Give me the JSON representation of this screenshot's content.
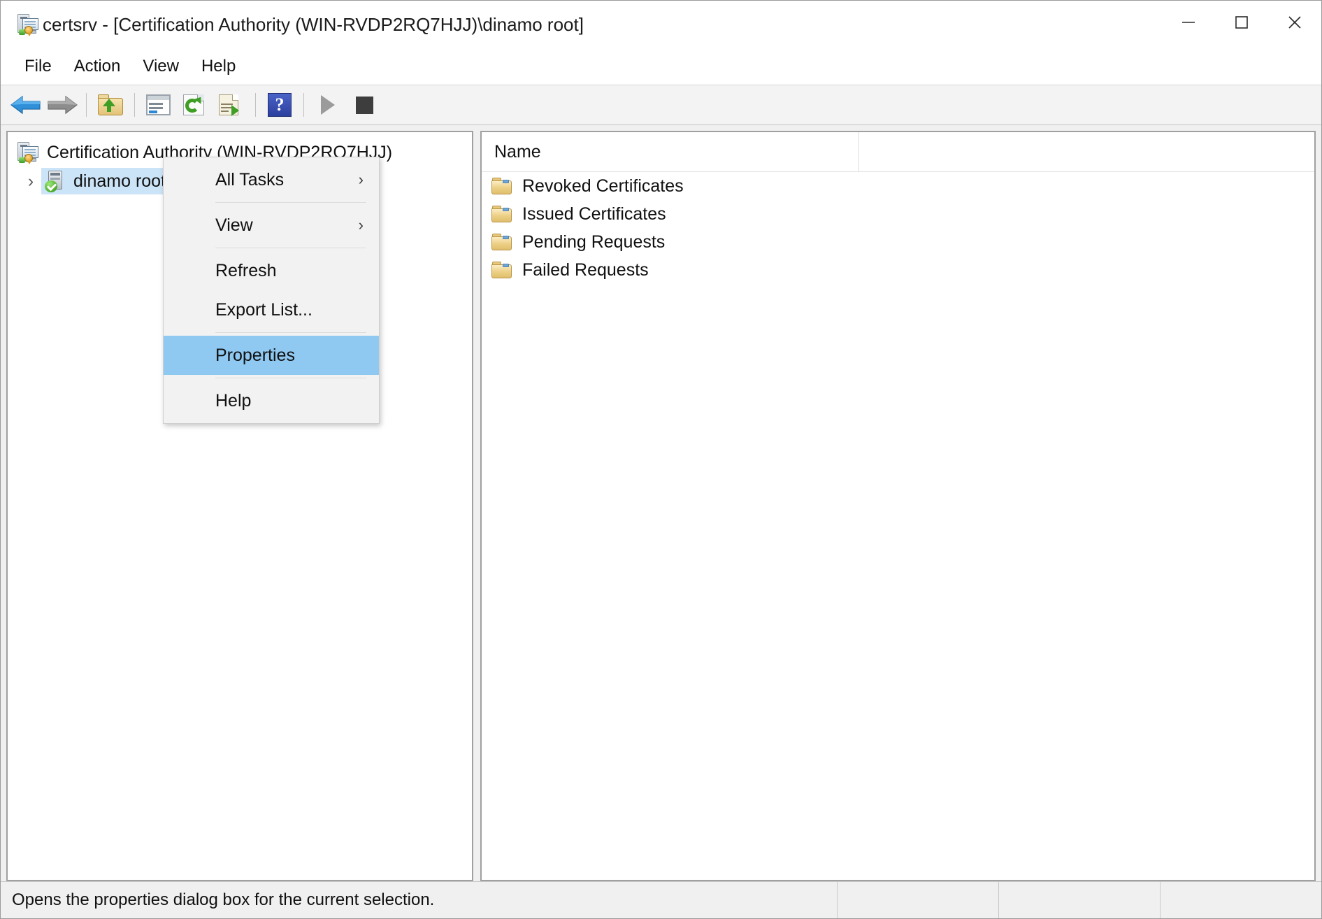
{
  "window": {
    "title": "certsrv - [Certification Authority (WIN-RVDP2RQ7HJJ)\\dinamo root]",
    "app_icon": "certificate-authority-icon",
    "caption": {
      "minimize_label": "Minimize",
      "maximize_label": "Maximize",
      "close_label": "Close"
    }
  },
  "menubar": {
    "items": [
      {
        "label": "File"
      },
      {
        "label": "Action"
      },
      {
        "label": "View"
      },
      {
        "label": "Help"
      }
    ]
  },
  "toolbar": {
    "buttons": [
      {
        "icon": "back-arrow-icon",
        "label": "Back"
      },
      {
        "icon": "forward-arrow-icon",
        "label": "Forward"
      },
      {
        "icon": "up-one-level-icon",
        "label": "Up One Level"
      },
      {
        "icon": "show-hide-console-tree-icon",
        "label": "Show/Hide Console Tree"
      },
      {
        "icon": "refresh-icon",
        "label": "Refresh"
      },
      {
        "icon": "export-list-icon",
        "label": "Export List"
      },
      {
        "icon": "help-icon",
        "label": "Help"
      },
      {
        "icon": "start-service-icon",
        "label": "Start Service"
      },
      {
        "icon": "stop-service-icon",
        "label": "Stop Service"
      }
    ]
  },
  "tree": {
    "root": {
      "label": "Certification Authority (WIN-RVDP2RQ7HJJ)",
      "icon": "certification-authority-icon"
    },
    "child": {
      "label": "dinamo root",
      "icon": "ca-server-icon",
      "chevron": "›",
      "selected": true
    }
  },
  "list": {
    "columns": [
      {
        "label": "Name"
      },
      {
        "label": ""
      }
    ],
    "rows": [
      {
        "name": "Revoked Certificates",
        "icon": "folder-icon"
      },
      {
        "name": "Issued Certificates",
        "icon": "folder-icon"
      },
      {
        "name": "Pending Requests",
        "icon": "folder-icon"
      },
      {
        "name": "Failed Requests",
        "icon": "folder-icon"
      }
    ]
  },
  "context_menu": {
    "items": [
      {
        "label": "All Tasks",
        "submenu": true,
        "arrow": "›",
        "highlight": false
      },
      {
        "label": "View",
        "submenu": true,
        "arrow": "›",
        "highlight": false
      },
      {
        "label": "Refresh",
        "submenu": false,
        "arrow": "",
        "highlight": false
      },
      {
        "label": "Export List...",
        "submenu": false,
        "arrow": "",
        "highlight": false
      },
      {
        "label": "Properties",
        "submenu": false,
        "arrow": "",
        "highlight": true
      },
      {
        "label": "Help",
        "submenu": false,
        "arrow": "",
        "highlight": false
      }
    ]
  },
  "statusbar": {
    "text": "Opens the properties dialog box for the current selection."
  },
  "colors": {
    "selection_blue": "#cce4f7",
    "menu_highlight": "#8fc9f2",
    "toolbar_bg": "#f3f3f3",
    "pane_border": "#a0a0a0",
    "folder_yellow": "#eccf84"
  }
}
